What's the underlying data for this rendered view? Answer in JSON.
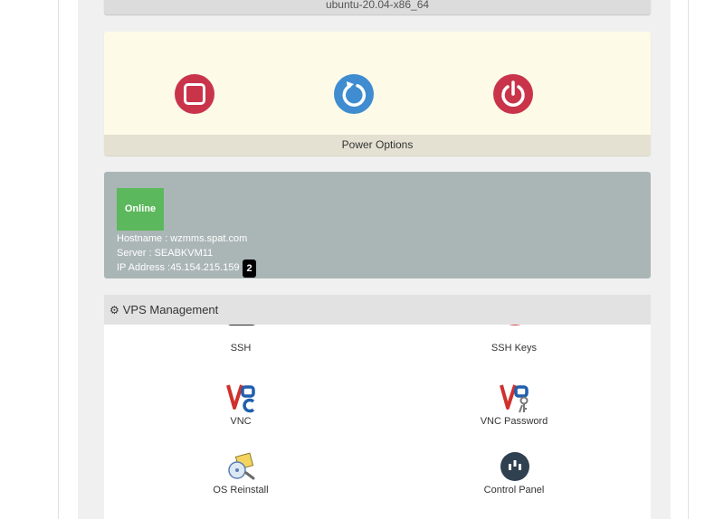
{
  "os": {
    "label": "ubuntu-20.04-x86_64"
  },
  "power": {
    "footer_label": "Power Options",
    "buttons": [
      {
        "name": "stop",
        "icon": "stop-icon",
        "color": "#c9344b"
      },
      {
        "name": "restart",
        "icon": "restart-icon",
        "color": "#3f8cd1"
      },
      {
        "name": "power",
        "icon": "power-icon",
        "color": "#c9344b"
      }
    ]
  },
  "status": {
    "badge": "Online",
    "badge_color": "#5cb85c",
    "hostname": "Hostname : wzmms.spat.com",
    "server": "Server : SEABKVM11",
    "ip": "IP Address :45.154.215.159",
    "counter": "2"
  },
  "vps": {
    "header": "VPS Management",
    "header_icon": "gear-icon",
    "tiles": [
      {
        "label": "SSH",
        "icon": "terminal-icon"
      },
      {
        "label": "SSH Keys",
        "icon": "key-icon"
      },
      {
        "label": "VNC",
        "icon": "vnc-icon"
      },
      {
        "label": "VNC Password",
        "icon": "vnc-password-icon"
      },
      {
        "label": "OS Reinstall",
        "icon": "os-reinstall-icon"
      },
      {
        "label": "Control Panel",
        "icon": "control-panel-icon"
      }
    ]
  }
}
